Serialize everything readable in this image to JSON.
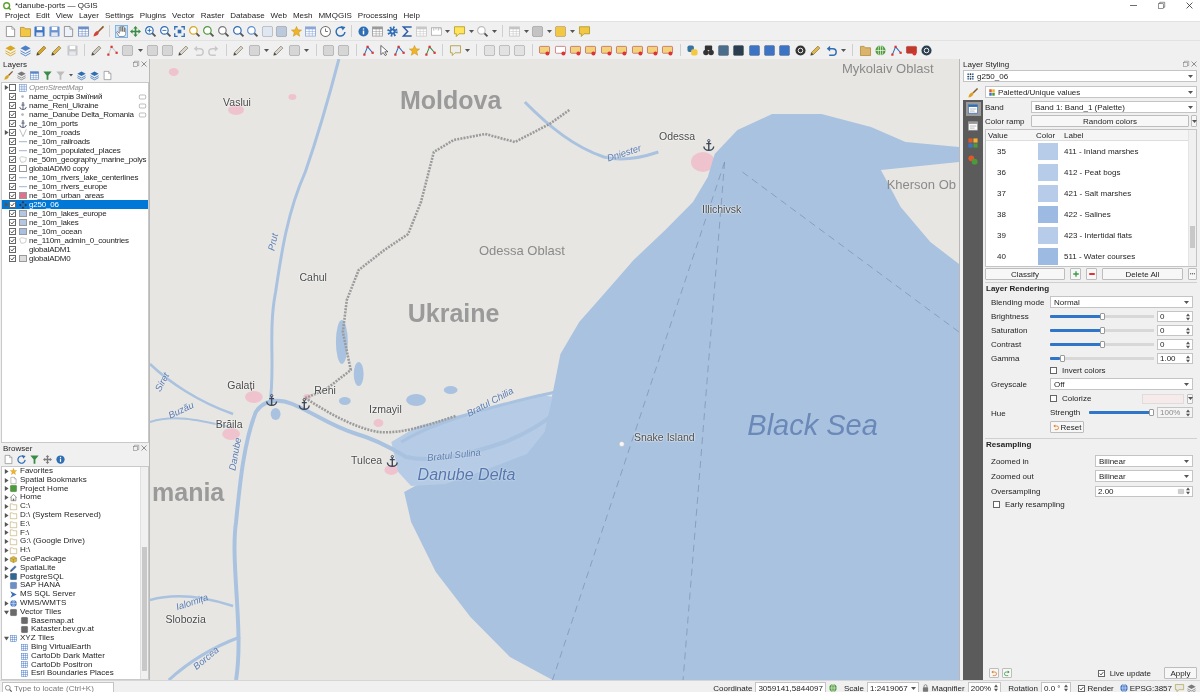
{
  "window": {
    "title": "*danube-ports — QGIS"
  },
  "menu": [
    "Project",
    "Edit",
    "View",
    "Layer",
    "Settings",
    "Plugins",
    "Vector",
    "Raster",
    "Database",
    "Web",
    "Mesh",
    "MMQGIS",
    "Processing",
    "Help"
  ],
  "toolbar": {
    "pan_tool": {
      "selected": true
    }
  },
  "layers_panel": {
    "title": "Layers",
    "layers": [
      {
        "name": "OpenStreetMap",
        "kind": "tiles",
        "checked": false,
        "expandable": true,
        "indicator": false,
        "selected": false
      },
      {
        "name": "name_острів Зміїний",
        "kind": "point",
        "checked": true,
        "expandable": false,
        "indicator": true,
        "selected": false
      },
      {
        "name": "name_Reni_Ukraine",
        "kind": "anchor",
        "checked": true,
        "expandable": false,
        "indicator": true,
        "selected": false
      },
      {
        "name": "name_Danube Delta_Romania",
        "kind": "point",
        "checked": true,
        "expandable": false,
        "indicator": true,
        "selected": false
      },
      {
        "name": "ne_10m_ports",
        "kind": "anchor",
        "checked": true,
        "expandable": false,
        "indicator": false,
        "selected": false
      },
      {
        "name": "ne_10m_roads",
        "kind": "roads",
        "checked": true,
        "expandable": true,
        "indicator": false,
        "selected": false
      },
      {
        "name": "ne_10m_railroads",
        "kind": "line",
        "checked": true,
        "expandable": false,
        "indicator": false,
        "selected": false
      },
      {
        "name": "ne_10m_populated_places",
        "kind": "line",
        "checked": true,
        "expandable": false,
        "indicator": false,
        "selected": false
      },
      {
        "name": "ne_50m_geography_marine_polys",
        "kind": "outline",
        "checked": true,
        "expandable": false,
        "indicator": false,
        "selected": false
      },
      {
        "name": "globalADM0 copy",
        "kind": "fill",
        "color": "#ffffff",
        "checked": true,
        "expandable": false,
        "indicator": false,
        "selected": false
      },
      {
        "name": "ne_10m_rivers_lake_centerlines",
        "kind": "line",
        "checked": true,
        "expandable": false,
        "indicator": false,
        "selected": false
      },
      {
        "name": "ne_10m_rivers_europe",
        "kind": "line",
        "checked": true,
        "expandable": false,
        "indicator": false,
        "selected": false
      },
      {
        "name": "ne_10m_urban_areas",
        "kind": "fill",
        "color": "#e0708e",
        "checked": true,
        "expandable": false,
        "indicator": false,
        "selected": false
      },
      {
        "name": "g250_06",
        "kind": "raster",
        "checked": true,
        "expandable": true,
        "indicator": false,
        "selected": true
      },
      {
        "name": "ne_10m_lakes_europe",
        "kind": "fill",
        "color": "#b3c7e3",
        "checked": true,
        "expandable": false,
        "indicator": false,
        "selected": false
      },
      {
        "name": "ne_10m_lakes",
        "kind": "fill",
        "color": "#b3c7e3",
        "checked": true,
        "expandable": false,
        "indicator": false,
        "selected": false
      },
      {
        "name": "ne_10m_ocean",
        "kind": "fill",
        "color": "#a9c1e0",
        "checked": true,
        "expandable": false,
        "indicator": false,
        "selected": false
      },
      {
        "name": "ne_110m_admin_0_countries",
        "kind": "outline",
        "checked": true,
        "expandable": false,
        "indicator": false,
        "selected": false
      },
      {
        "name": "globalADM1",
        "kind": "none",
        "checked": true,
        "expandable": false,
        "indicator": false,
        "selected": false
      },
      {
        "name": "globalADM0",
        "kind": "fill",
        "color": "#dddddd",
        "checked": true,
        "expandable": false,
        "indicator": false,
        "selected": false
      }
    ]
  },
  "browser": {
    "title": "Browser",
    "items": [
      {
        "name": "Favorites",
        "kind": "favorites",
        "expandable": true,
        "expanded": false
      },
      {
        "name": "Spatial Bookmarks",
        "kind": "bookmarks",
        "expandable": true,
        "expanded": false
      },
      {
        "name": "Project Home",
        "kind": "project",
        "expandable": true,
        "expanded": false
      },
      {
        "name": "Home",
        "kind": "home",
        "expandable": true,
        "expanded": false
      },
      {
        "name": "C:\\",
        "kind": "drive",
        "expandable": true,
        "expanded": false
      },
      {
        "name": "D:\\ (System Reserved)",
        "kind": "drive",
        "expandable": true,
        "expanded": false
      },
      {
        "name": "E:\\",
        "kind": "drive",
        "expandable": true,
        "expanded": false
      },
      {
        "name": "F:\\",
        "kind": "drive",
        "expandable": true,
        "expanded": false
      },
      {
        "name": "G:\\ (Google Drive)",
        "kind": "drive",
        "expandable": true,
        "expanded": false
      },
      {
        "name": "H:\\",
        "kind": "drive",
        "expandable": true,
        "expanded": false
      },
      {
        "name": "GeoPackage",
        "kind": "geopackage",
        "expandable": true,
        "expanded": false
      },
      {
        "name": "SpatiaLite",
        "kind": "spatialite",
        "expandable": true,
        "expanded": false
      },
      {
        "name": "PostgreSQL",
        "kind": "postgresql",
        "expandable": true,
        "expanded": false
      },
      {
        "name": "SAP HANA",
        "kind": "hana",
        "expandable": false
      },
      {
        "name": "MS SQL Server",
        "kind": "mssql",
        "expandable": false
      },
      {
        "name": "WMS/WMTS",
        "kind": "wms",
        "expandable": true,
        "expanded": false
      },
      {
        "name": "Vector Tiles",
        "kind": "vector-tiles",
        "expandable": true,
        "expanded": true,
        "children": [
          {
            "name": "Basemap.at",
            "kind": "vector-tile",
            "expandable": false
          },
          {
            "name": "Kataster.bev.gv.at",
            "kind": "vector-tile",
            "expandable": false
          }
        ]
      },
      {
        "name": "XYZ Tiles",
        "kind": "xyz",
        "expandable": true,
        "expanded": true,
        "children": [
          {
            "name": "Bing VirtualEarth",
            "kind": "xyz-tile",
            "expandable": false
          },
          {
            "name": "CartoDb Dark Matter",
            "kind": "xyz-tile",
            "expandable": false
          },
          {
            "name": "CartoDb Positron",
            "kind": "xyz-tile",
            "expandable": false
          },
          {
            "name": "Esri Boundaries Places",
            "kind": "xyz-tile",
            "expandable": false
          }
        ]
      }
    ]
  },
  "map": {
    "labels": [
      {
        "text": "Mykolaiv Oblast",
        "kind": "region"
      },
      {
        "text": "Vaslui",
        "kind": "city"
      },
      {
        "text": "Moldova",
        "kind": "country"
      },
      {
        "text": "Odessa",
        "kind": "city"
      },
      {
        "text": "Dniester",
        "kind": "river"
      },
      {
        "text": "Kherson Ob",
        "kind": "region"
      },
      {
        "text": "Illichivsk",
        "kind": "city"
      },
      {
        "text": "Prut",
        "kind": "river"
      },
      {
        "text": "Odessa Oblast",
        "kind": "region"
      },
      {
        "text": "Cahul",
        "kind": "city"
      },
      {
        "text": "Ukraine",
        "kind": "country"
      },
      {
        "text": "Siret",
        "kind": "river"
      },
      {
        "text": "Galați",
        "kind": "city"
      },
      {
        "text": "Reni",
        "kind": "city"
      },
      {
        "text": "Buzău",
        "kind": "river"
      },
      {
        "text": "Izmayil",
        "kind": "city"
      },
      {
        "text": "Brăila",
        "kind": "city"
      },
      {
        "text": "Bratul Chilia",
        "kind": "river"
      },
      {
        "text": "Danube",
        "kind": "river"
      },
      {
        "text": "Snake Island",
        "kind": "city"
      },
      {
        "text": "Black Sea",
        "kind": "sea"
      },
      {
        "text": "Tulcea",
        "kind": "city"
      },
      {
        "text": "Bratul Sulina",
        "kind": "river"
      },
      {
        "text": "mania",
        "kind": "country"
      },
      {
        "text": "Danube Delta",
        "kind": "area"
      },
      {
        "text": "Ialomița",
        "kind": "river"
      },
      {
        "text": "Slobozia",
        "kind": "city"
      },
      {
        "text": "Borcea",
        "kind": "river"
      }
    ]
  },
  "styling_panel": {
    "title": "Layer Styling",
    "layer": "g250_06",
    "renderer": "Paletted/Unique values",
    "side_tabs": [
      {
        "selected": true
      },
      {
        "selected": false
      },
      {
        "selected": false
      },
      {
        "selected": false
      }
    ],
    "band_label": "Band",
    "band": "Band 1: Band_1 (Palette)",
    "ramp_label": "Color ramp",
    "ramp": "Random colors",
    "table": {
      "columns": [
        "Value",
        "Color",
        "Label"
      ],
      "rows": [
        {
          "value": "35",
          "color": "#b7cce8",
          "label": "411 - Inland marshes"
        },
        {
          "value": "36",
          "color": "#b7cce8",
          "label": "412 - Peat bogs"
        },
        {
          "value": "37",
          "color": "#b7cce8",
          "label": "421 - Salt marshes"
        },
        {
          "value": "38",
          "color": "#9dbbe2",
          "label": "422 - Salines"
        },
        {
          "value": "39",
          "color": "#b7cce8",
          "label": "423 - Intertidal flats"
        },
        {
          "value": "40",
          "color": "#9dbbe2",
          "label": "511 - Water courses"
        }
      ]
    },
    "classify": "Classify",
    "delete_all": "Delete All",
    "rendering": {
      "title": "Layer Rendering",
      "blending_label": "Blending mode",
      "blending": "Normal",
      "sliders": [
        {
          "name": "Brightness",
          "level": 0.5,
          "value": "0"
        },
        {
          "name": "Saturation",
          "level": 0.5,
          "value": "0"
        },
        {
          "name": "Contrast",
          "level": 0.5,
          "value": "0"
        },
        {
          "name": "Gamma",
          "level": 0.1,
          "value": "1.00"
        }
      ],
      "invert": {
        "label": "Invert colors",
        "checked": false
      },
      "greyscale_label": "Greyscale",
      "greyscale": "Off",
      "hue_label": "Hue",
      "colorize": {
        "label": "Colorize",
        "checked": false
      },
      "strength": {
        "label": "Strength",
        "level": 1,
        "value": "100%",
        "disabled": true
      },
      "reset": "Reset"
    },
    "resampling": {
      "title": "Resampling",
      "zoomed_in_label": "Zoomed in",
      "zoomed_in": "Bilinear",
      "zoomed_out_label": "Zoomed out",
      "zoomed_out": "Bilinear",
      "oversampling_label": "Oversampling",
      "oversampling": "2.00",
      "early": {
        "label": "Early resampling",
        "checked": false
      }
    },
    "live_update": {
      "label": "Live update",
      "checked": true
    },
    "apply": "Apply"
  },
  "status_bar": {
    "locator": {
      "placeholder": "Type to locate (Ctrl+K)"
    },
    "coordinate_label": "Coordinate",
    "coordinate": "3059141,5844097",
    "scale_label": "Scale",
    "scale": "1:2419067",
    "magnifier_label": "Magnifier",
    "magnifier": "200%",
    "rotation_label": "Rotation",
    "rotation": "0.0 °",
    "render": {
      "label": "Render",
      "checked": true
    },
    "crs": "EPSG:3857"
  }
}
